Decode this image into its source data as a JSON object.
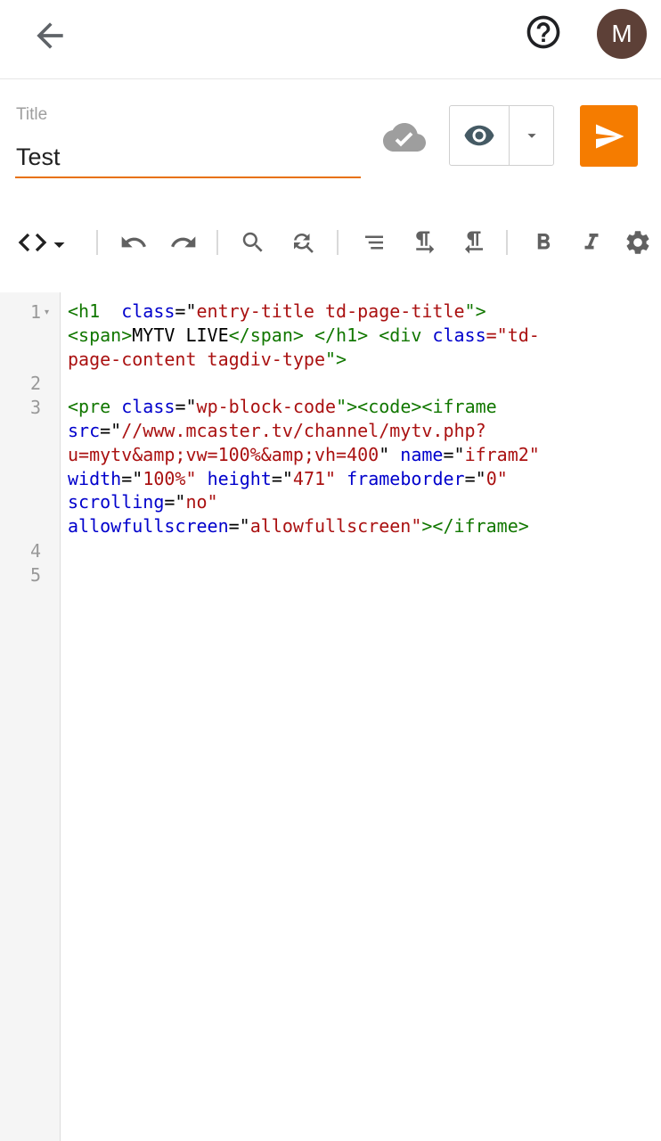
{
  "header": {
    "back_icon": "arrow-back-icon",
    "help_icon": "help-circle-icon",
    "avatar_initial": "M"
  },
  "title_field": {
    "label": "Title",
    "value": "Test"
  },
  "actions": {
    "save_status_icon": "cloud-check-icon",
    "preview_icon": "eye-icon",
    "preview_dropdown_icon": "caret-down-icon",
    "publish_icon": "send-icon",
    "publish_color": "#f57c00",
    "accent_color": "#e8710a"
  },
  "toolbar": {
    "items": [
      "code-view-icon",
      "undo-icon",
      "redo-icon",
      "search-icon",
      "find-replace-icon",
      "format-icon",
      "ltr-icon",
      "rtl-icon",
      "bold-icon",
      "italic-icon",
      "settings-icon"
    ]
  },
  "editor": {
    "line_numbers": [
      "1",
      "2",
      "3",
      "4",
      "5"
    ],
    "lines": [
      [
        "<h1 ",
        " class",
        "=\"",
        "entry-title td-page-title",
        "\">"
      ],
      [
        "<span>",
        "MYTV LIVE",
        "</span> </h1> <div ",
        "class",
        "=\"td-"
      ],
      [
        "page-content tagdiv-type",
        "\">"
      ],
      [],
      [
        "<pre ",
        "class",
        "=\"",
        "wp-block-code",
        "\"><code><iframe"
      ],
      [
        "src",
        "=\"",
        "//www.mcaster.tv/channel/mytv.php?"
      ],
      [
        "u=mytv&amp;vw=100%&amp;vh=400",
        "\" ",
        "name",
        "=\"",
        "ifram2\""
      ],
      [
        "width",
        "=\"",
        "100%\"",
        " height",
        "=\"",
        "471\"",
        " frameborder",
        "=\"",
        "0\""
      ],
      [
        "scrolling",
        "=\"",
        "no\""
      ],
      [
        "allowfullscreen",
        "=\"",
        "allowfullscreen\"",
        "></iframe>"
      ]
    ]
  }
}
